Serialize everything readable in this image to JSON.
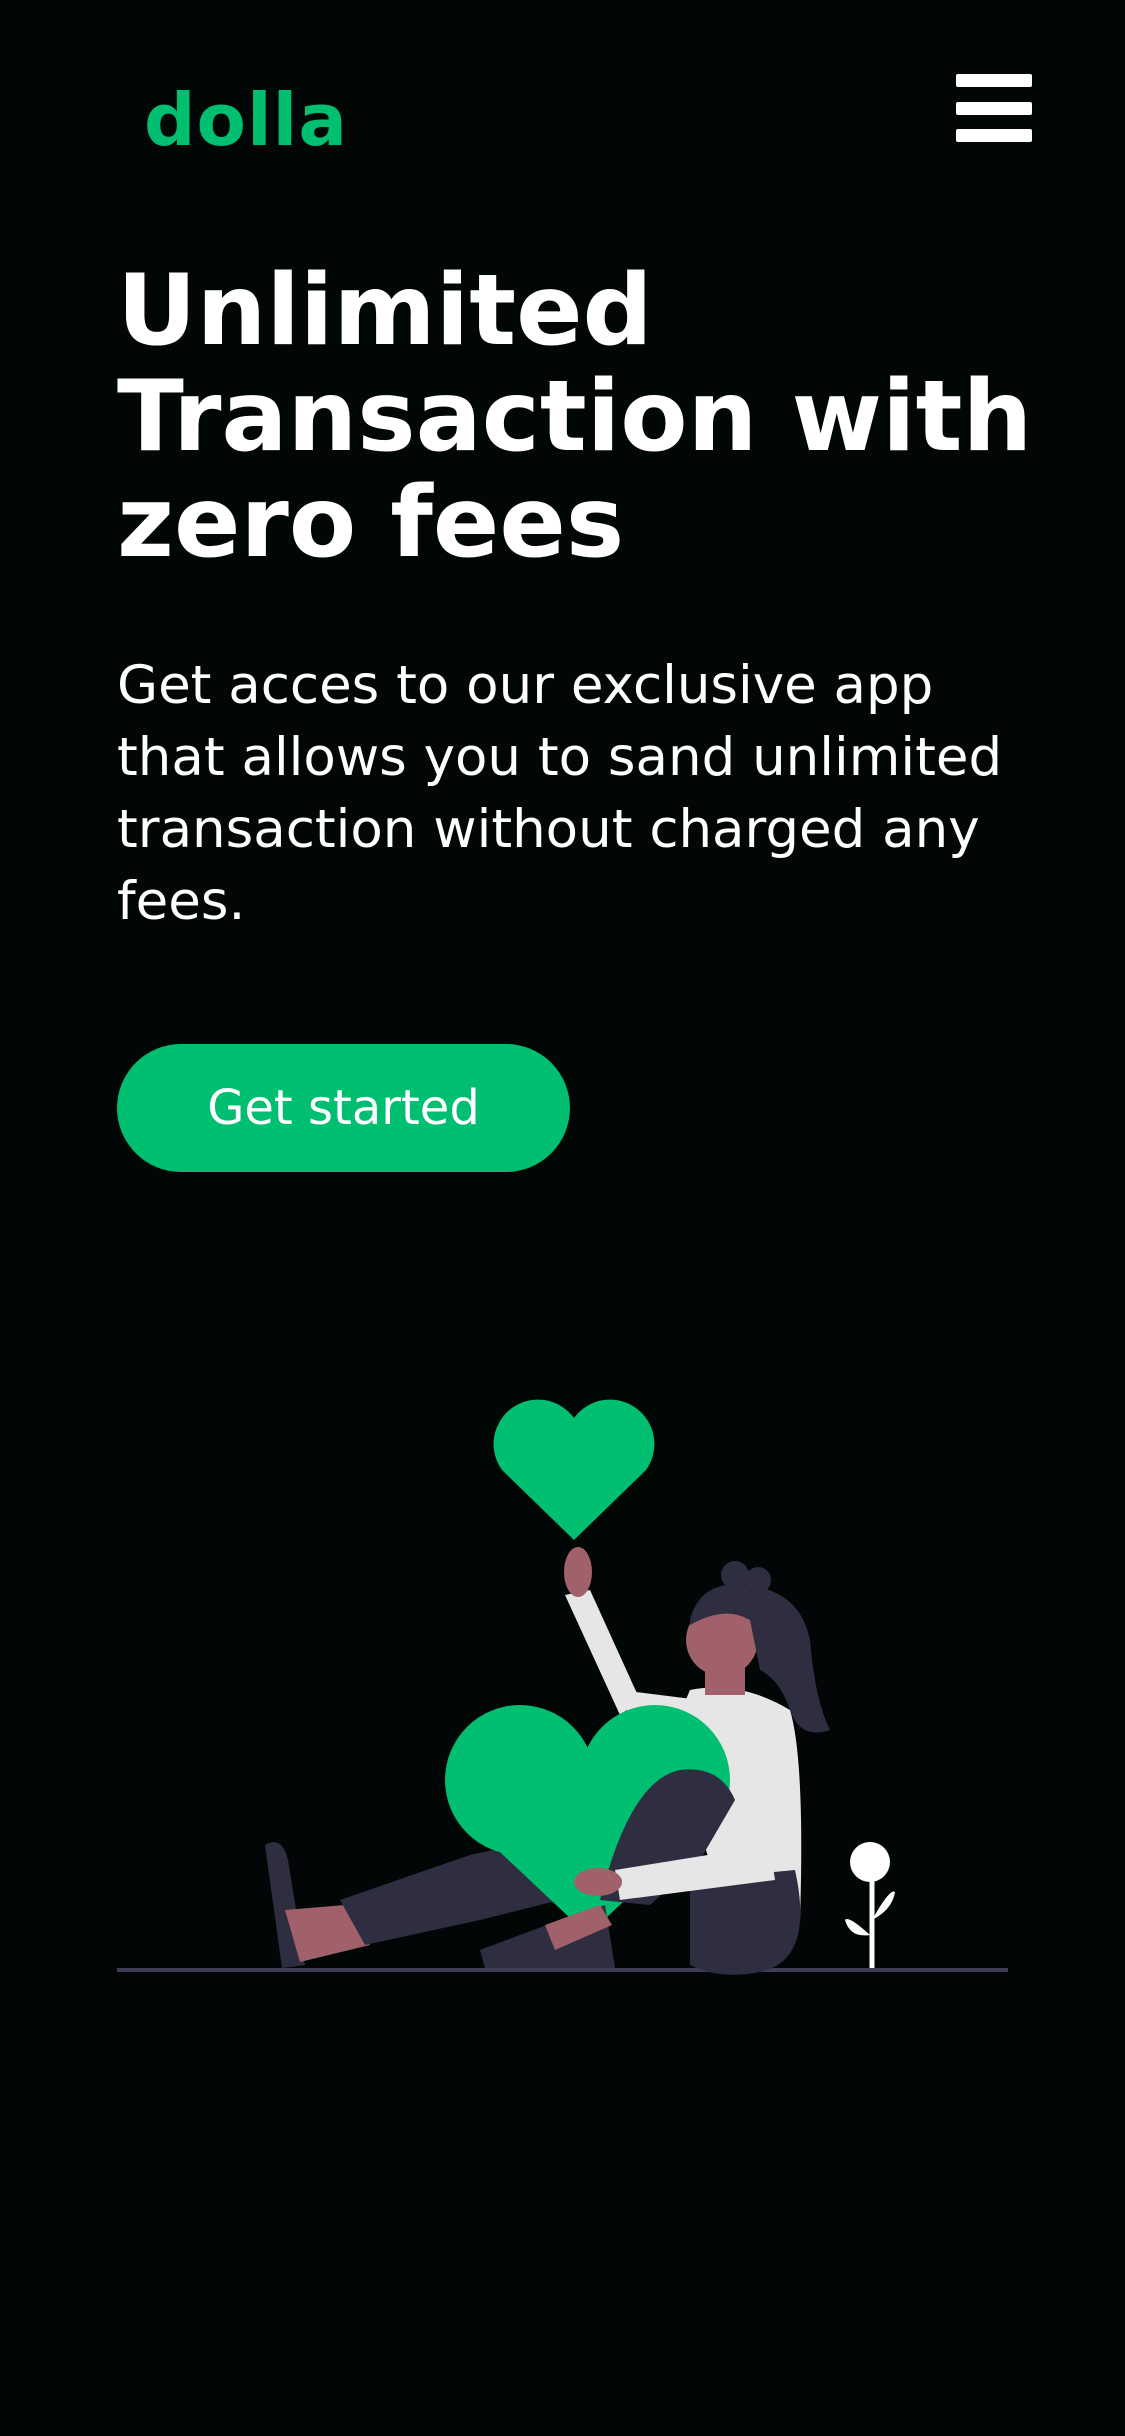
{
  "nav": {
    "logo": "dolla",
    "menu_icon": "hamburger-menu-icon"
  },
  "hero": {
    "headline": "Unlimited Transaction with zero fees",
    "subtext": "Get acces to our exclusive app that allows you to sand unlimited transaction without charged any fees.",
    "cta_label": "Get started"
  },
  "colors": {
    "background": "#010606",
    "accent": "#01bf71",
    "text": "#ffffff"
  },
  "illustration": {
    "icons": [
      "heart-icon",
      "person-illustration",
      "flower-icon"
    ]
  }
}
